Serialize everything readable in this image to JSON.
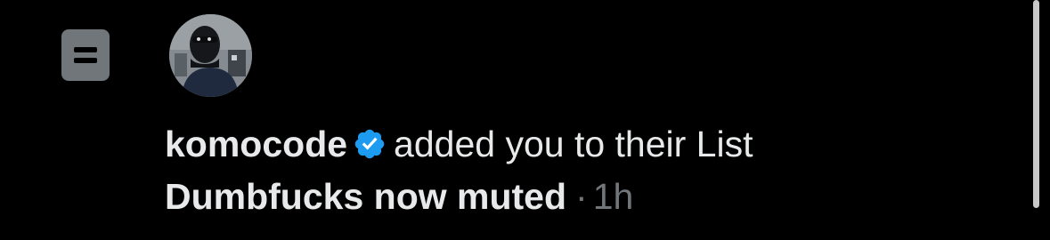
{
  "notification": {
    "icon": "list-icon",
    "avatar_icon": "user-avatar",
    "username": "komocode",
    "verified_icon": "verified-badge-icon",
    "action_text": "added you to their List",
    "list_name": "Dumbfucks now muted",
    "separator": "·",
    "time": "1h"
  },
  "colors": {
    "background": "#000000",
    "text_primary": "#e7e9ea",
    "text_secondary": "#71767b",
    "verified_blue": "#1d9bf0",
    "list_icon_bg": "#71767b"
  }
}
